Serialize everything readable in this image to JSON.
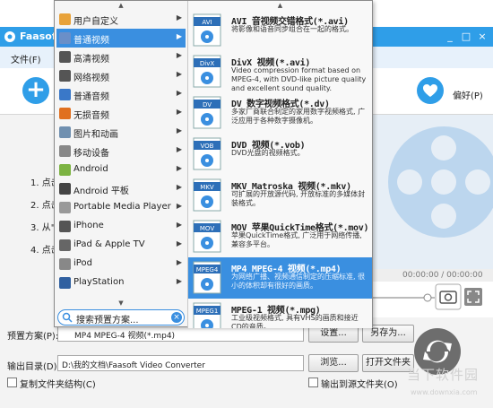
{
  "window": {
    "title": "Faasoft",
    "controls": [
      "_",
      "□",
      "×"
    ]
  },
  "menubar": {
    "items": [
      "文件(F)"
    ]
  },
  "toolbar": {
    "add_icon": "plus-icon",
    "fav_label": "偏好(P)"
  },
  "steps": [
    "1. 点击",
    "2. 点击",
    "3. 从\"",
    "4. 点击"
  ],
  "preview": {
    "time": "00:00:00 / 00:00:00"
  },
  "bottom": {
    "profile_label": "预置方案(P):",
    "profile_value": "MP4 MPEG-4 视频(*.mp4)",
    "settings_button": "设置...",
    "save_as_button": "另存为...",
    "output_label": "输出目录(D):",
    "output_value": "D:\\我的文档\\Faasoft Video Converter",
    "browse_button": "浏览...",
    "open_folder_button": "打开文件夹",
    "copy_structure_label": "复制文件夹结构(C)",
    "output_to_source_label": "输出到源文件夹(O)"
  },
  "watermark": {
    "text": "当下软件园",
    "url": "www.downxia.com"
  },
  "popup": {
    "categories": [
      {
        "label": "用户自定义",
        "icon": "user-icon",
        "color": "#e8a23a"
      },
      {
        "label": "普通视频",
        "icon": "film-icon",
        "color": "#6a8fc8",
        "selected": true
      },
      {
        "label": "高清视频",
        "icon": "hd-film-icon",
        "color": "#555555"
      },
      {
        "label": "网络视频",
        "icon": "web-video-icon",
        "color": "#555555"
      },
      {
        "label": "普通音频",
        "icon": "music-icon",
        "color": "#3a78c8"
      },
      {
        "label": "无损音频",
        "icon": "lossless-audio-icon",
        "color": "#e07020"
      },
      {
        "label": "图片和动画",
        "icon": "picture-icon",
        "color": "#7090b0"
      },
      {
        "label": "移动设备",
        "icon": "mobile-icon",
        "color": "#888888"
      },
      {
        "label": "Android",
        "icon": "android-icon",
        "color": "#7cb342"
      },
      {
        "label": "Android 平板",
        "icon": "android-tablet-icon",
        "color": "#444444"
      },
      {
        "label": "Portable Media Player",
        "icon": "media-player-icon",
        "color": "#999999"
      },
      {
        "label": "iPhone",
        "icon": "iphone-icon",
        "color": "#555555"
      },
      {
        "label": "iPad & Apple TV",
        "icon": "ipad-icon",
        "color": "#666666"
      },
      {
        "label": "iPod",
        "icon": "ipod-icon",
        "color": "#888888"
      },
      {
        "label": "PlayStation",
        "icon": "playstation-icon",
        "color": "#3060a0"
      }
    ],
    "search_placeholder": "搜索预置方案...",
    "formats": [
      {
        "badge": "AVI",
        "title": "AVI 音视频交错格式(*.avi)",
        "desc": "将影像和语音同步组合在一起的格式。"
      },
      {
        "badge": "DivX",
        "title": "DivX 视频(*.avi)",
        "desc": "Video compression format based on MPEG-4, with DVD-like picture quality and excellent sound quality."
      },
      {
        "badge": "DV",
        "title": "DV 数字视频格式(*.dv)",
        "desc": "多家厂商联合制定的家用数字视频格式, 广泛应用于各种数字摄像机。"
      },
      {
        "badge": "VOB",
        "title": "DVD 视频(*.vob)",
        "desc": "DVD光盘的视频格式。"
      },
      {
        "badge": "MKV",
        "title": "MKV Matroska 视频(*.mkv)",
        "desc": "可扩展的开放源代码, 开放标准的多媒体封装格式。"
      },
      {
        "badge": "MOV",
        "title": "MOV 苹果QuickTime格式(*.mov)",
        "desc": "苹果QuickTime格式, 广泛用于网络传播, 兼容多平台。"
      },
      {
        "badge": "MPEG4",
        "title": "MP4 MPEG-4 视频(*.mp4)",
        "desc": "为网络广播、视频通信制定的压缩标准, 很小的体积却有很好的画质。",
        "selected": true
      },
      {
        "badge": "MPEG1",
        "title": "MPEG-1 视频(*.mpg)",
        "desc": "工业级视频格式, 具有VHS的画质和接近CD的音质。"
      }
    ]
  }
}
